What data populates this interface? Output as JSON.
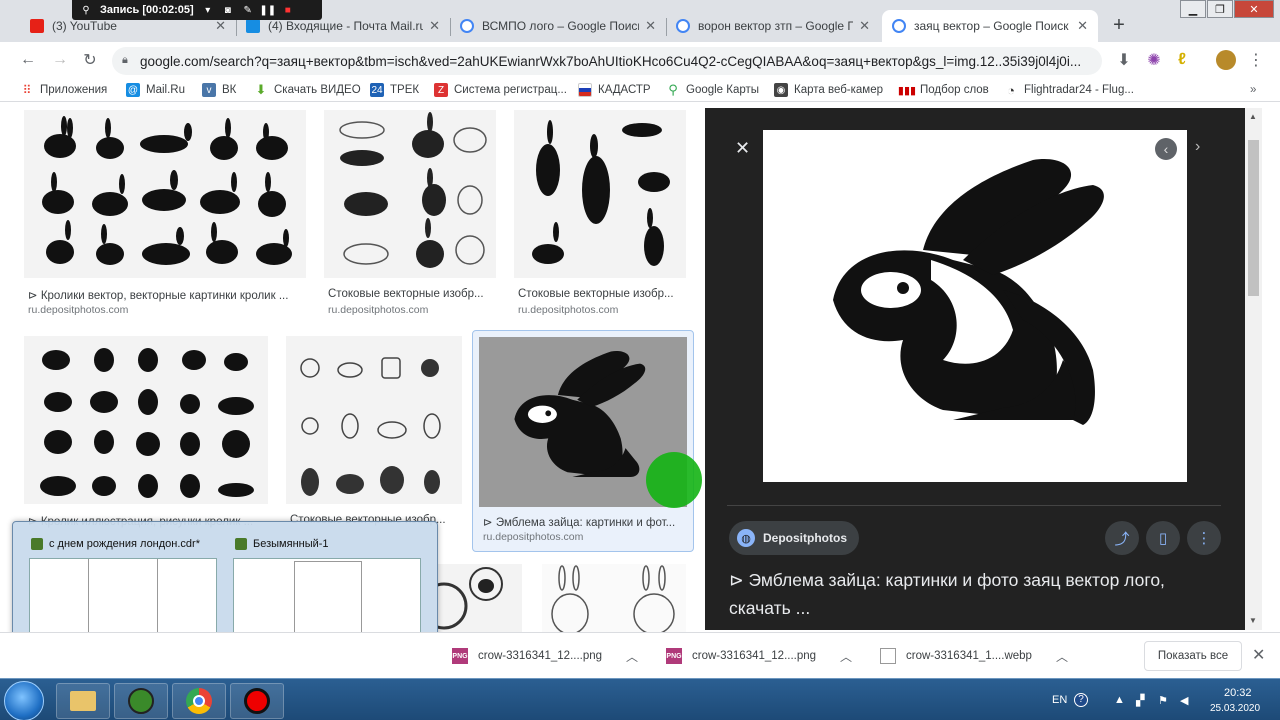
{
  "recorder": {
    "label": "Запись [00:02:05]"
  },
  "tabs": [
    {
      "title": "(3) YouTube",
      "fav_color": "#e62117"
    },
    {
      "title": "(4) Входящие - Почта Mail.ru",
      "fav_color": "#168de2"
    },
    {
      "title": "ВСМПО лого – Google Поиск",
      "fav_color": "#4285f4"
    },
    {
      "title": "ворон вектор зтп – Google Поиск",
      "fav_color": "#4285f4"
    },
    {
      "title": "заяц вектор – Google Поиск",
      "fav_color": "#4285f4"
    }
  ],
  "new_tab": "+",
  "address": {
    "url": "google.com/search?q=заяц+вектор&tbm=isch&ved=2ahUKEwianrWxk7boAhUItioKHco6Cu4Q2-cCegQIABAA&oq=заяц+вектор&gs_l=img.12..35i39j0l4j0i..."
  },
  "bookmarks": [
    {
      "label": "Приложения",
      "icon": "apps-grid-icon",
      "color": "#e94235"
    },
    {
      "label": "Mail.Ru",
      "icon": "mail-icon",
      "color": "#168de2"
    },
    {
      "label": "ВК",
      "icon": "vk-icon",
      "color": "#4a76a8"
    },
    {
      "label": "Скачать ВИДЕО",
      "icon": "download-arrow-icon",
      "color": "#5aaa2a"
    },
    {
      "label": "ТРЕК",
      "icon": "calendar-icon",
      "color": "#1f62b5"
    },
    {
      "label": "Система регистрац...",
      "icon": "z-icon",
      "color": "#d33"
    },
    {
      "label": "КАДАСТР",
      "icon": "flag-icon",
      "color": "#c33"
    },
    {
      "label": "Google Карты",
      "icon": "map-pin-icon",
      "color": "#34a853"
    },
    {
      "label": "Карта веб-камер",
      "icon": "webcam-icon",
      "color": "#555"
    },
    {
      "label": "Подбор слов",
      "icon": "bars-icon",
      "color": "#c00"
    },
    {
      "label": "Flightradar24 - Flug...",
      "icon": "radar-icon",
      "color": "#333"
    }
  ],
  "results": [
    {
      "caption": "⊳ Кролики вектор, векторные картинки кролик ...",
      "source": "ru.depositphotos.com"
    },
    {
      "caption": "Стоковые векторные изобр...",
      "source": "ru.depositphotos.com"
    },
    {
      "caption": "Стоковые векторные изобр...",
      "source": "ru.depositphotos.com"
    },
    {
      "caption": "⊳ Кролик иллюстрация, рисунки кролик ...",
      "source": ""
    },
    {
      "caption": "Стоковые векторные изобр...",
      "source": ""
    },
    {
      "caption": "⊳ Эмблема зайца: картинки и фот...",
      "source": "ru.depositphotos.com"
    }
  ],
  "preview": {
    "source": "Depositphotos",
    "title": "⊳ Эмблема зайца: картинки и фото заяц вектор лого, скачать ..."
  },
  "thumbnails": [
    {
      "title": "с днем рождения лондон.cdr*"
    },
    {
      "title": "Безымянный-1"
    }
  ],
  "downloads": [
    {
      "name": "crow-3316341_12....png",
      "type": "PNG"
    },
    {
      "name": "crow-3316341_12....png",
      "type": "PNG"
    },
    {
      "name": "crow-3316341_1....webp",
      "type": ""
    }
  ],
  "show_all": "Показать все",
  "tray": {
    "lang": "EN",
    "time": "20:32",
    "date": "25.03.2020"
  }
}
